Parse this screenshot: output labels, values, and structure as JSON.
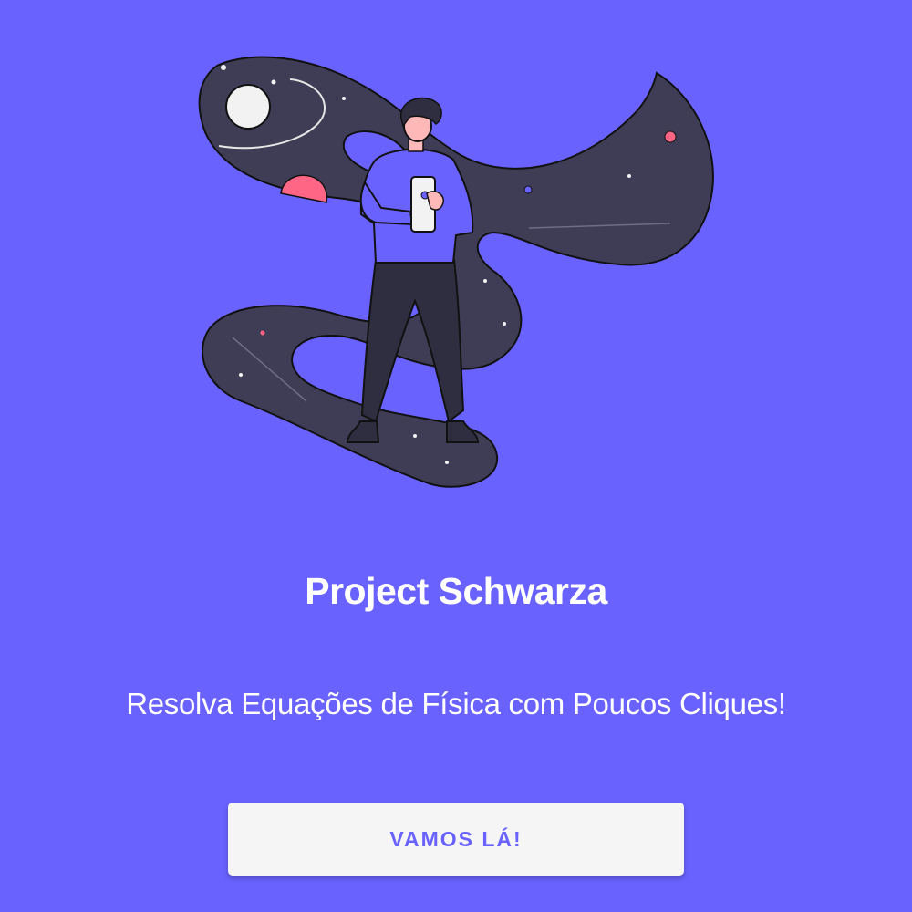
{
  "app": {
    "title": "Project Schwarza",
    "subtitle": "Resolva Equações de Física com Poucos Cliques!",
    "cta_label": "VAMOS LÁ!"
  },
  "illustration": {
    "name": "space-explorer-illustration",
    "icon": "person-in-space-illustration"
  },
  "colors": {
    "background": "#6a62fe",
    "button_bg": "#f5f5f5",
    "button_text": "#6a62fe",
    "space_ribbon": "#3f3d56",
    "planet_pink": "#ff6584",
    "title_text": "#ffffff"
  }
}
